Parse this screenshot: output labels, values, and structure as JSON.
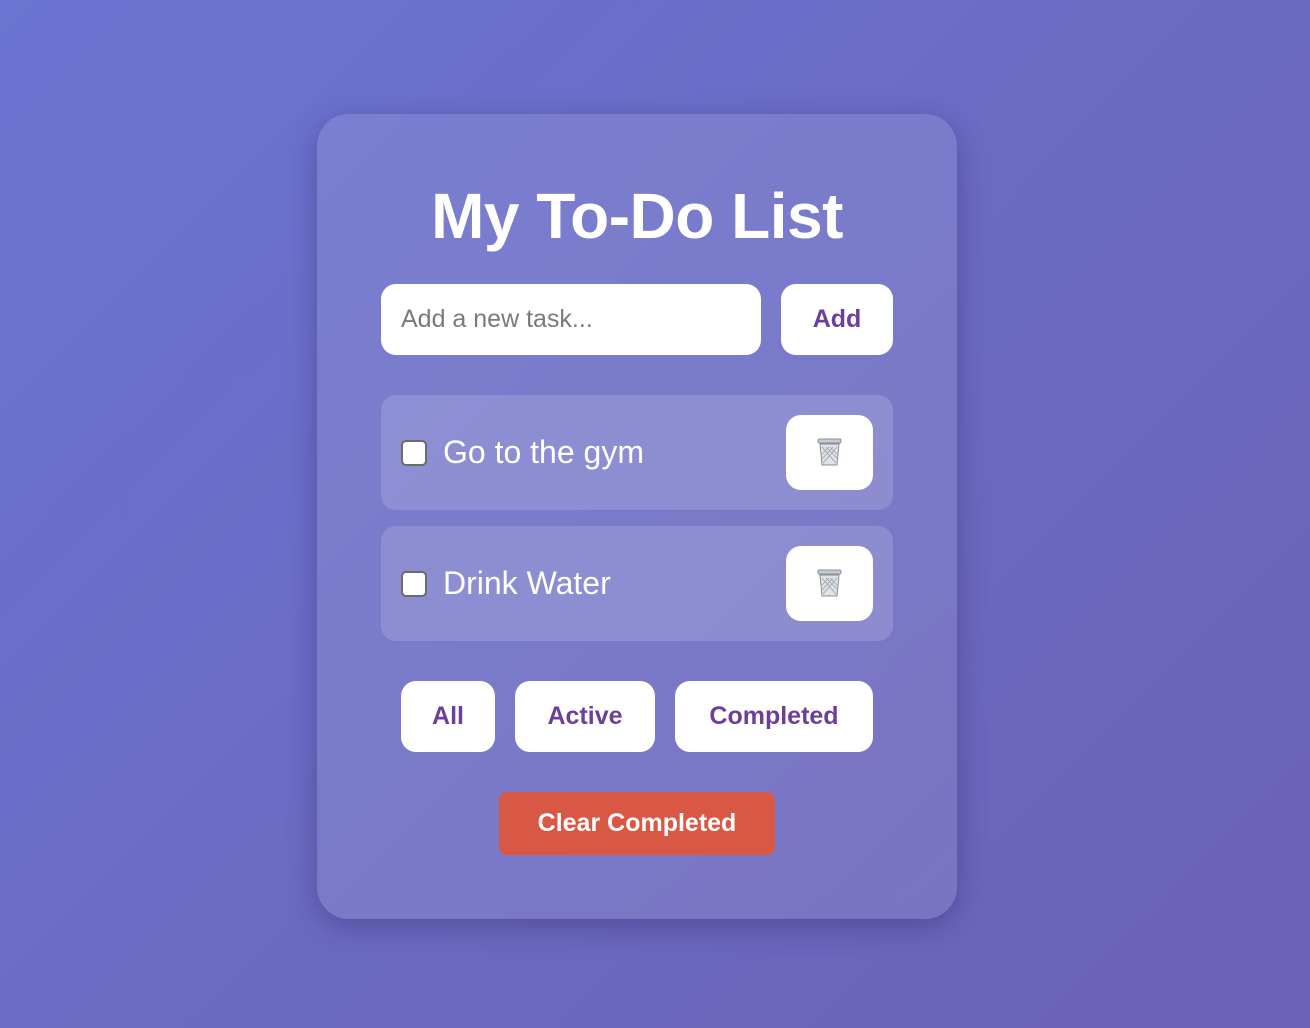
{
  "title": "My To-Do List",
  "input": {
    "placeholder": "Add a new task...",
    "value": ""
  },
  "add_button_label": "Add",
  "tasks": [
    {
      "text": "Go to the gym",
      "completed": false,
      "delete_icon": "trash-icon"
    },
    {
      "text": "Drink Water",
      "completed": false,
      "delete_icon": "trash-icon"
    }
  ],
  "filters": {
    "all": "All",
    "active": "Active",
    "completed": "Completed"
  },
  "clear_button_label": "Clear Completed",
  "colors": {
    "background_start": "#6a75d1",
    "background_end": "#6c61b6",
    "accent_text": "#6c3f99",
    "clear_button": "#d85745"
  }
}
